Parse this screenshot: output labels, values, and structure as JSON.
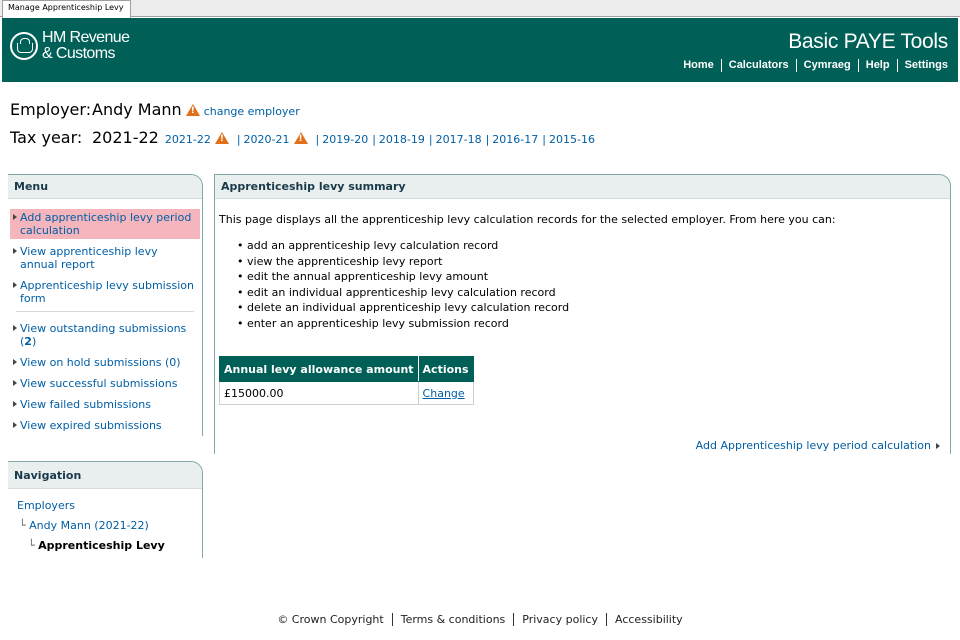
{
  "window": {
    "tab_title": "Manage Apprenticeship Levy"
  },
  "header": {
    "logo_line1": "HM Revenue",
    "logo_line2": "& Customs",
    "app_title": "Basic PAYE Tools",
    "nav": [
      "Home",
      "Calculators",
      "Cymraeg",
      "Help",
      "Settings"
    ]
  },
  "employer": {
    "label": "Employer:",
    "name": "Andy Mann",
    "change_link": "change employer"
  },
  "tax_year": {
    "label": "Tax year:",
    "current": "2021-22",
    "years": [
      "2021-22",
      "2020-21",
      "2019-20",
      "2018-19",
      "2017-18",
      "2016-17",
      "2015-16"
    ]
  },
  "menu": {
    "title": "Menu",
    "items": [
      "Add apprenticeship levy period calculation",
      "View apprenticeship levy annual report",
      "Apprenticeship levy submission form"
    ],
    "submissions": {
      "outstanding_label": "View outstanding submissions (",
      "outstanding_count": "2",
      "outstanding_close": ")",
      "on_hold": "View on hold submissions (0)",
      "successful": "View successful submissions",
      "failed": "View failed submissions",
      "expired": "View expired submissions"
    }
  },
  "navigation": {
    "title": "Navigation",
    "level1": "Employers",
    "level2": "Andy Mann (2021-22)",
    "level3": "Apprenticeship Levy"
  },
  "main": {
    "title": "Apprenticeship levy summary",
    "intro": "This page displays all the apprenticeship levy calculation records for the selected employer. From here you can:",
    "bullets": [
      "add an apprenticeship levy calculation record",
      "view the apprenticeship levy report",
      "edit the annual apprenticeship levy amount",
      "edit an individual apprenticeship levy calculation record",
      "delete an individual apprenticeship levy calculation record",
      "enter an apprenticeship levy submission record"
    ],
    "table": {
      "headers": [
        "Annual levy allowance amount",
        "Actions"
      ],
      "rows": [
        [
          "£15000.00",
          "Change"
        ]
      ]
    },
    "add_link": "Add Apprenticeship levy period calculation"
  },
  "footer": {
    "copyright": "© Crown Copyright",
    "terms": "Terms & conditions",
    "privacy": "Privacy policy",
    "accessibility": "Accessibility"
  },
  "colors": {
    "brand": "#005f56",
    "link": "#005ea5",
    "active_menu": "#f5b5bd",
    "warning": "#e0701a"
  }
}
